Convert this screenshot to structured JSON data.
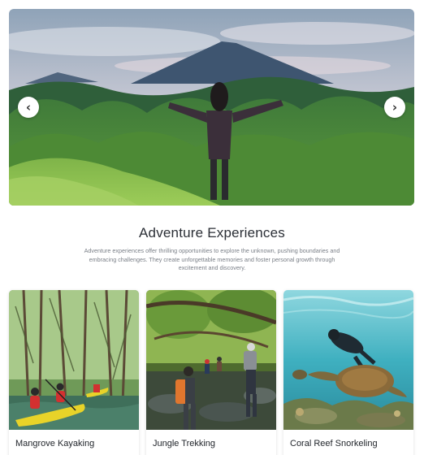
{
  "hero": {
    "prev_label": "‹",
    "next_label": "›"
  },
  "section": {
    "title": "Adventure Experiences",
    "description": "Adventure experiences offer thrilling opportunities to explore the unknown, pushing boundaries and embracing challenges. They create unforgettable memories and foster personal growth through excitement and discovery."
  },
  "cards": [
    {
      "title": "Mangrove Kayaking"
    },
    {
      "title": "Jungle Trekking"
    },
    {
      "title": "Coral Reef Snorkeling"
    }
  ],
  "colors": {
    "title_text": "#2b2f36",
    "body_text": "#7a7f87",
    "nav_button": "#ffffff"
  }
}
